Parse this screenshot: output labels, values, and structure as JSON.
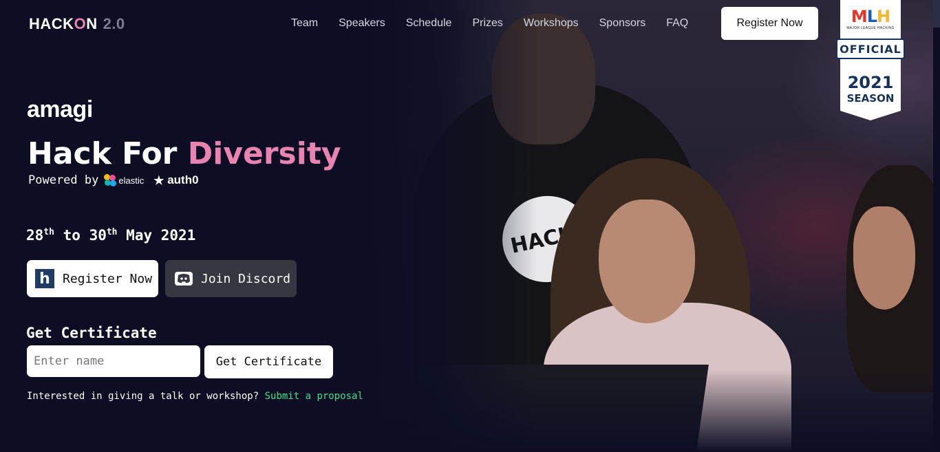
{
  "nav": {
    "logo": {
      "main_a": "HACK",
      "main_o": "O",
      "main_b": "N",
      "version": "2.0"
    },
    "links": [
      "Team",
      "Speakers",
      "Schedule",
      "Prizes",
      "Workshops",
      "Sponsors",
      "FAQ"
    ],
    "register_label": "Register Now"
  },
  "mlh_badge": {
    "m": "M",
    "l": "L",
    "h": "H",
    "subtitle": "MAJOR LEAGUE HACKING",
    "official": "OFFICIAL",
    "year": "2021",
    "season": "SEASON",
    "colors": {
      "m": "#e73427",
      "l": "#1a5db4",
      "h": "#f7b529",
      "navy": "#16325c"
    }
  },
  "hero": {
    "sponsor_logo": "amagi",
    "title_prefix": "Hack For",
    "title_accent": "Diversity",
    "powered_by": "Powered by",
    "sponsors": [
      "elastic",
      "auth0"
    ],
    "dates": {
      "start_num": "28",
      "start_sup": "th",
      "to": "to",
      "end_num": "30",
      "end_sup": "th",
      "month_year": "May 2021"
    },
    "register_button": {
      "label": "Register Now",
      "icon": "devfolio-h-icon"
    },
    "discord_button": {
      "label": "Join Discord",
      "icon": "discord-icon"
    },
    "photo_badge_text": "HACK!"
  },
  "certificate": {
    "heading": "Get Certificate",
    "input_placeholder": "Enter name",
    "input_value": "",
    "button_label": "Get Certificate"
  },
  "proposal": {
    "text": "Interested in giving a talk or workshop?",
    "link_label": "Submit a proposal"
  },
  "theme": {
    "background": "#0d0e24",
    "accent_pink": "#e983b2",
    "link_green": "#3ee08f"
  }
}
